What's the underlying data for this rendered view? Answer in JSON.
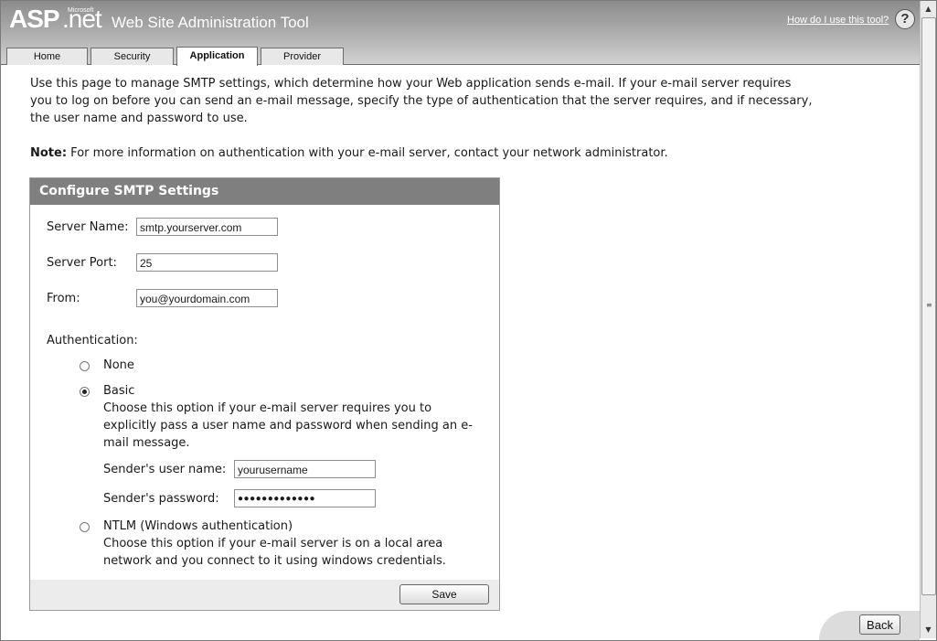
{
  "header": {
    "logo_asp": "ASP",
    "logo_net": ".net",
    "logo_ms": "Microsoft",
    "title": "Web Site Administration Tool",
    "help_link": "How do I use this tool?",
    "help_icon_text": "?"
  },
  "tabs": [
    {
      "label": "Home"
    },
    {
      "label": "Security"
    },
    {
      "label": "Application",
      "active": true
    },
    {
      "label": "Provider"
    }
  ],
  "intro": "Use this page to manage SMTP settings, which determine how your Web application sends e-mail. If your e-mail server requires you to log on before you can send an e-mail message, specify the type of authentication that the server requires, and if necessary, the user name and password to use.",
  "note": {
    "label": "Note:",
    "text": " For more information on authentication with your e-mail server, contact your network administrator."
  },
  "smtp": {
    "title": "Configure SMTP Settings",
    "server_name_label": "Server Name:",
    "server_name_value": "smtp.yourserver.com",
    "server_port_label": "Server Port:",
    "server_port_value": "25",
    "from_label": "From:",
    "from_value": "you@yourdomain.com",
    "auth_label": "Authentication:",
    "options": {
      "none": {
        "label": "None",
        "selected": false
      },
      "basic": {
        "label": "Basic",
        "selected": true,
        "desc": [
          "Choose this option if your e-mail server requires you to",
          "explicitly pass a user name and password when sending an e-",
          "mail message."
        ]
      },
      "ntlm": {
        "label": "NTLM (Windows authentication)",
        "selected": false,
        "desc": [
          "Choose this option if your e-mail server is on a local area",
          "network and you connect to it using windows credentials."
        ]
      }
    },
    "username_label": "Sender's user name:",
    "username_value": "yourusername",
    "password_label": "Sender's password:",
    "password_value": "●●●●●●●●●●●●●",
    "save_label": "Save"
  },
  "back_label": "Back",
  "scrollbar": {
    "up_icon": "▲",
    "down_icon": "▼",
    "grip": "≡"
  }
}
